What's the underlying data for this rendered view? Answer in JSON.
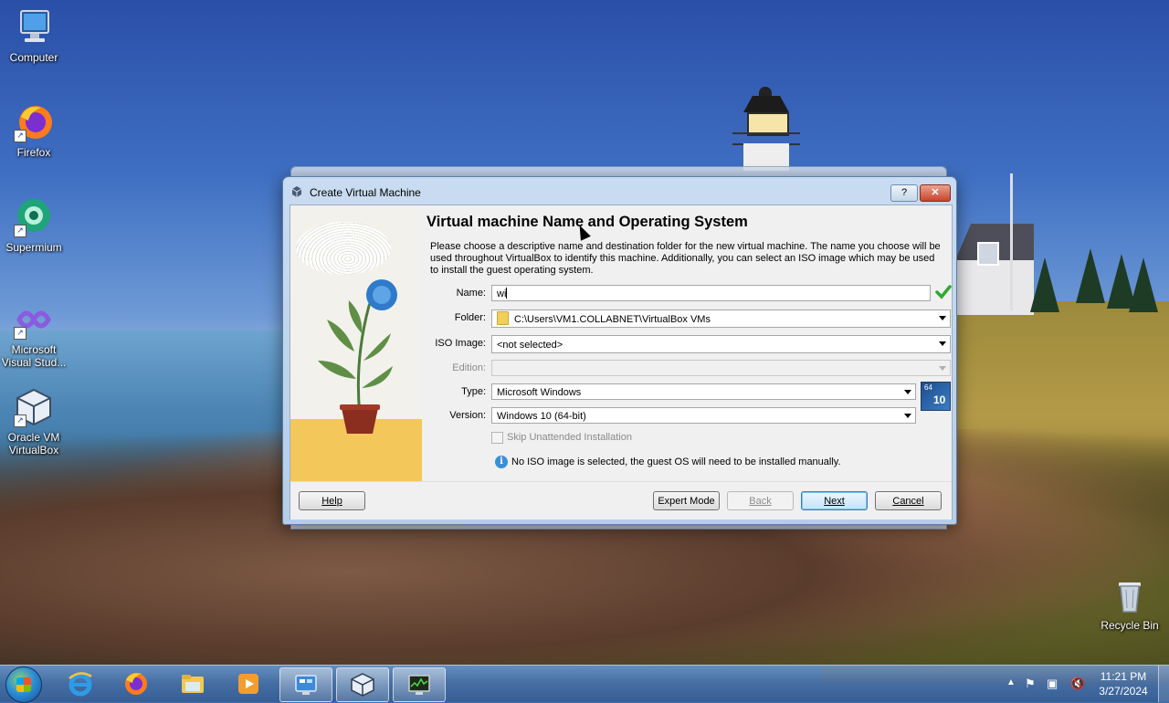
{
  "desktop": {
    "icons": [
      {
        "label": "Computer",
        "icon": "computer-icon"
      },
      {
        "label": "Firefox",
        "icon": "firefox-icon"
      },
      {
        "label": "Supermium",
        "icon": "supermium-icon"
      },
      {
        "label": "Microsoft Visual Stud...",
        "icon": "visual-studio-icon"
      },
      {
        "label": "Oracle VM VirtualBox",
        "icon": "virtualbox-icon"
      },
      {
        "label": "Recycle Bin",
        "icon": "recycle-bin-icon"
      }
    ]
  },
  "dialog": {
    "title": "Create Virtual Machine",
    "help_title_button": "?",
    "close_title_button": "✕",
    "heading": "Virtual machine Name and Operating System",
    "description": "Please choose a descriptive name and destination folder for the new virtual machine. The name you choose will be used throughout VirtualBox to identify this machine. Additionally, you can select an ISO image which may be used to install the guest operating system.",
    "fields": {
      "name_label": "Name:",
      "name_value": "wi",
      "folder_label": "Folder:",
      "folder_value": "C:\\Users\\VM1.COLLABNET\\VirtualBox VMs",
      "iso_label": "ISO Image:",
      "iso_value": "<not selected>",
      "edition_label": "Edition:",
      "edition_value": "",
      "type_label": "Type:",
      "type_value": "Microsoft Windows",
      "version_label": "Version:",
      "version_value": "Windows 10 (64-bit)",
      "os_badge_top": "64",
      "os_badge_num": "10"
    },
    "skip_unattended_label": "Skip Unattended Installation",
    "skip_unattended_checked": false,
    "info_text": "No ISO image is selected, the guest OS will need to be installed manually.",
    "buttons": {
      "help": "Help",
      "expert_mode": "Expert Mode",
      "back": "Back",
      "next": "Next",
      "cancel": "Cancel"
    }
  },
  "taskbar": {
    "apps": [
      {
        "icon": "internet-explorer-icon",
        "active": false
      },
      {
        "icon": "firefox-icon",
        "active": false
      },
      {
        "icon": "file-explorer-icon",
        "active": false
      },
      {
        "icon": "media-player-icon",
        "active": false
      },
      {
        "icon": "control-panel-icon",
        "active": true
      },
      {
        "icon": "virtualbox-icon",
        "active": true
      },
      {
        "icon": "task-manager-icon",
        "active": true
      }
    ],
    "clock_time": "11:21 PM",
    "clock_date": "3/27/2024"
  },
  "colors": {
    "accent": "#3c7fb1",
    "valid_check": "#2fa82f",
    "info": "#3a8fd8"
  }
}
